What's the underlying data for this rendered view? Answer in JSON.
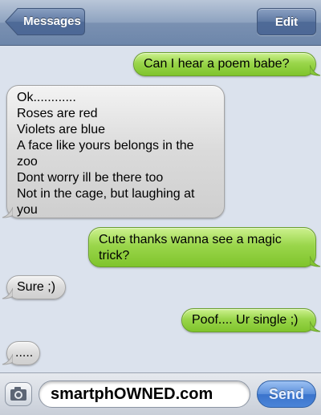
{
  "header": {
    "back_label": "Messages",
    "edit_label": "Edit"
  },
  "messages": [
    {
      "sender": "me",
      "lines": [
        "Can I hear a poem babe?"
      ]
    },
    {
      "sender": "them",
      "lines": [
        "Ok............",
        "Roses are red",
        "Violets are blue",
        "A face like yours belongs in the",
        "zoo",
        "Dont worry ill be there too",
        "Not in the cage, but laughing at",
        "you"
      ]
    },
    {
      "sender": "me",
      "lines": [
        "Cute thanks wanna see a magic",
        "trick?"
      ]
    },
    {
      "sender": "them",
      "lines": [
        "Sure ;)"
      ]
    },
    {
      "sender": "me",
      "lines": [
        "Poof.... Ur single ;)"
      ]
    },
    {
      "sender": "them",
      "lines": [
        "....."
      ]
    }
  ],
  "composer": {
    "text": "smartphOWNED.com",
    "send_label": "Send"
  },
  "icons": {
    "camera": "camera-icon",
    "back": "chevron-left-icon"
  },
  "colors": {
    "sent_bubble": "#8fd04a",
    "received_bubble": "#d8d8d8",
    "background": "#dbe2ed",
    "send_button": "#4a84d8"
  }
}
